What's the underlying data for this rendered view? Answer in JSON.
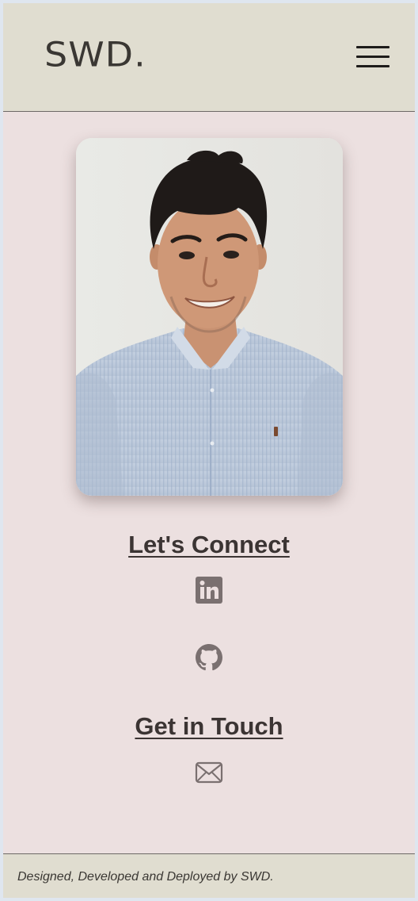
{
  "header": {
    "logo_text": "SWD.",
    "menu_icon": "hamburger-menu-icon"
  },
  "profile": {
    "photo": "profile-photo"
  },
  "connect": {
    "heading": "Let's Connect",
    "links": [
      {
        "icon": "linkedin-icon"
      },
      {
        "icon": "github-icon"
      }
    ]
  },
  "contact": {
    "heading": "Get in Touch",
    "links": [
      {
        "icon": "email-envelope-icon"
      }
    ]
  },
  "footer": {
    "text": "Designed, Developed and Deployed by SWD."
  },
  "colors": {
    "page_background": "#ece0e0",
    "header_background": "#e0ddd0",
    "text_dark": "#3b3433",
    "icon_gray": "#7a7070"
  }
}
